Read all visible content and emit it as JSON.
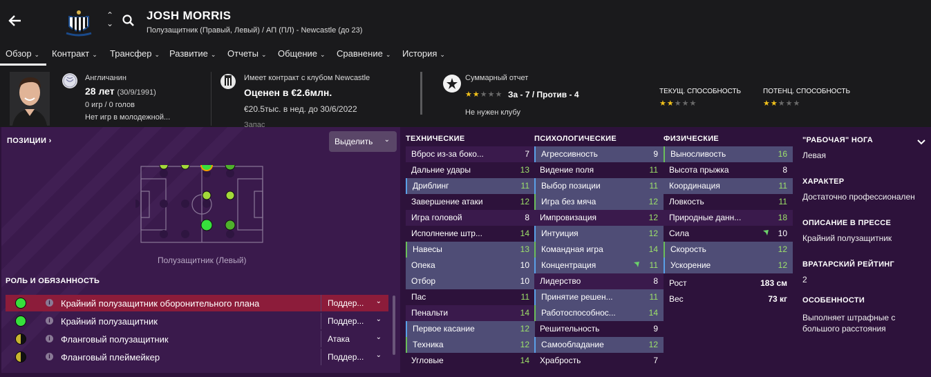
{
  "player": {
    "name": "JOSH MORRIS",
    "subtitle": "Полузащитник (Правый, Левый) / АП (ПЛ) - Newcastle (до 23)"
  },
  "nav": [
    "Обзор",
    "Контракт",
    "Трансфер",
    "Развитие",
    "Отчеты",
    "Общение",
    "Сравнение",
    "История"
  ],
  "info": {
    "nationality": "Англичанин",
    "age": "28 лет",
    "birth": "(30/9/1991)",
    "games": "0 игр / 0 голов",
    "youth": "Нет игр в молодежной...",
    "contract": "Имеет контракт с клубом Newcastle",
    "value": "Оценен в €2.6млн.",
    "wage": "€20.5тыс. в нед. до 30/6/2022",
    "cut_text": "Запас",
    "report_label": "Суммарный отчет",
    "report_score": "За - 7 / Против - 4",
    "report_note": "Не нужен клубу",
    "ca_label": "ТЕКУЩ. СПОСОБНОСТЬ",
    "pa_label": "ПОТЕНЦ. СПОСОБНОСТЬ",
    "ca_stars": 2,
    "pa_stars": 2,
    "report_stars": 2
  },
  "positions": {
    "title": "ПОЗИЦИИ",
    "select_label": "Выделить",
    "current_label": "Полузащитник (Левый)"
  },
  "roles": {
    "title": "РОЛЬ И ОБЯЗАННОСТЬ",
    "items": [
      {
        "name": "Крайний полузащитник оборонительного плана",
        "duty": "Поддер...",
        "dot": "#37e03c",
        "selected": true
      },
      {
        "name": "Крайний полузащитник",
        "duty": "Поддер...",
        "dot": "#37e03c",
        "selected": false
      },
      {
        "name": "Фланговый полузащитник",
        "duty": "Атака",
        "dot": "half",
        "selected": false
      },
      {
        "name": "Фланговый плеймейкер",
        "duty": "Поддер...",
        "dot": "half",
        "selected": false
      }
    ]
  },
  "technical": {
    "title": "ТЕХНИЧЕСКИЕ",
    "rows": [
      {
        "n": "Вброс из-за боко...",
        "v": "7"
      },
      {
        "n": "Дальние удары",
        "v": "13"
      },
      {
        "n": "Дриблинг",
        "v": "11"
      },
      {
        "n": "Завершение атаки",
        "v": "12"
      },
      {
        "n": "Игра головой",
        "v": "8"
      },
      {
        "n": "Исполнение штр...",
        "v": "14"
      },
      {
        "n": "Навесы",
        "v": "13"
      },
      {
        "n": "Опека",
        "v": "10"
      },
      {
        "n": "Отбор",
        "v": "10"
      },
      {
        "n": "Пас",
        "v": "11"
      },
      {
        "n": "Пенальти",
        "v": "14"
      },
      {
        "n": "Первое касание",
        "v": "12"
      },
      {
        "n": "Техника",
        "v": "12"
      },
      {
        "n": "Угловые",
        "v": "14"
      }
    ]
  },
  "mental": {
    "title": "ПСИХОЛОГИЧЕСКИЕ",
    "rows": [
      {
        "n": "Агрессивность",
        "v": "9"
      },
      {
        "n": "Видение поля",
        "v": "11"
      },
      {
        "n": "Выбор позиции",
        "v": "11"
      },
      {
        "n": "Игра без мяча",
        "v": "12"
      },
      {
        "n": "Импровизация",
        "v": "12"
      },
      {
        "n": "Интуиция",
        "v": "12"
      },
      {
        "n": "Командная игра",
        "v": "14"
      },
      {
        "n": "Концентрация",
        "v": "11"
      },
      {
        "n": "Лидерство",
        "v": "8"
      },
      {
        "n": "Принятие решен...",
        "v": "11"
      },
      {
        "n": "Работоспособнос...",
        "v": "14"
      },
      {
        "n": "Решительность",
        "v": "9"
      },
      {
        "n": "Самообладание",
        "v": "12"
      },
      {
        "n": "Храбрость",
        "v": "7"
      }
    ]
  },
  "physical": {
    "title": "ФИЗИЧЕСКИЕ",
    "rows": [
      {
        "n": "Выносливость",
        "v": "16"
      },
      {
        "n": "Высота прыжка",
        "v": "8"
      },
      {
        "n": "Координация",
        "v": "11"
      },
      {
        "n": "Ловкость",
        "v": "11"
      },
      {
        "n": "Природные данн...",
        "v": "18"
      },
      {
        "n": "Сила",
        "v": "10"
      },
      {
        "n": "Скорость",
        "v": "12"
      },
      {
        "n": "Ускорение",
        "v": "12"
      }
    ],
    "height_label": "Рост",
    "height": "183 см",
    "weight_label": "Вес",
    "weight": "73 кг"
  },
  "side": {
    "foot_title": "\"РАБОЧАЯ\" НОГА",
    "foot": "Левая",
    "char_title": "ХАРАКТЕР",
    "char": "Достаточно профессионален",
    "press_title": "ОПИСАНИЕ В ПРЕССЕ",
    "press": "Крайний полузащитник",
    "gk_title": "ВРАТАРСКИЙ РЕЙТИНГ",
    "gk": "2",
    "traits_title": "ОСОБЕННОСТИ",
    "traits": "Выполняет штрафные с большого расстояния"
  }
}
